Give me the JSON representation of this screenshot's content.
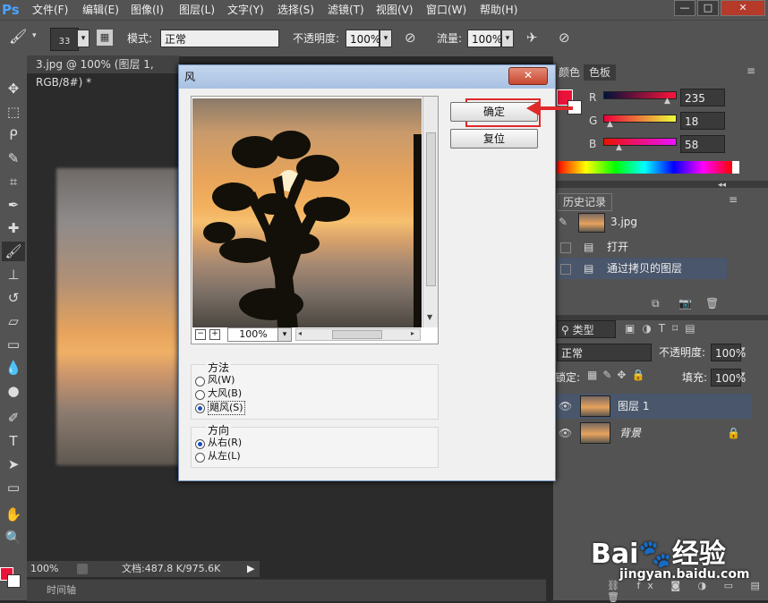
{
  "app": {
    "logo": "Ps"
  },
  "menu": [
    "文件(F)",
    "编辑(E)",
    "图像(I)",
    "图层(L)",
    "文字(Y)",
    "选择(S)",
    "滤镜(T)",
    "视图(V)",
    "窗口(W)",
    "帮助(H)"
  ],
  "options": {
    "brush_size": "33",
    "mode_label": "模式:",
    "mode_value": "正常",
    "opacity_label": "不透明度:",
    "opacity_value": "100%",
    "flow_label": "流量:",
    "flow_value": "100%"
  },
  "document": {
    "tab_title": "3.jpg @ 100% (图层 1, RGB/8#) *",
    "zoom": "100%",
    "doc_info": "文档:487.8 K/975.6K",
    "timeline": "时间轴"
  },
  "color_panel": {
    "tabs": [
      "颜色",
      "色板"
    ],
    "r_label": "R",
    "r_value": "235",
    "g_label": "G",
    "g_value": "18",
    "b_label": "B",
    "b_value": "58",
    "foreground": "#eb123a"
  },
  "history_panel": {
    "tab": "历史记录",
    "snapshot": "3.jpg",
    "items": [
      "打开",
      "通过拷贝的图层"
    ]
  },
  "layers_panel": {
    "filter_label": "类型",
    "blend_mode": "正常",
    "opacity_label": "不透明度:",
    "opacity_value": "100%",
    "lock_label": "锁定:",
    "fill_label": "填充:",
    "fill_value": "100%",
    "layers": [
      "图层 1",
      "背景"
    ]
  },
  "dialog": {
    "title": "风",
    "close": "✕",
    "ok": "确定",
    "reset": "复位",
    "zoom": "100%",
    "method_label": "方法",
    "methods": [
      "风(W)",
      "大风(B)",
      "飓风(S)"
    ],
    "direction_label": "方向",
    "directions": [
      "从右(R)",
      "从左(L)"
    ]
  },
  "watermark": {
    "brand": "Bai",
    "brand2": "经验",
    "url": "jingyan.baidu.com"
  },
  "colors": {
    "accent_red": "#e0282a",
    "panel_bg": "#535353"
  }
}
